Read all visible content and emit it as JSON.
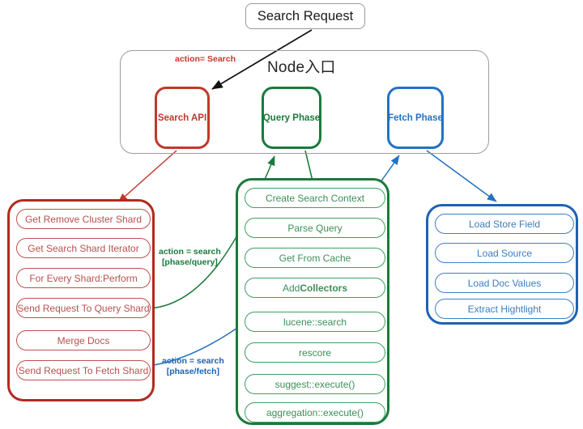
{
  "colors": {
    "red_dark": "#b22a20",
    "red": "#c0392b",
    "red_light": "#c0504d",
    "green": "#1a7a3c",
    "green_light": "#3f9e62",
    "blue": "#2272c4",
    "blue_dark": "#1b63b5",
    "blue_light": "#3f7fc4",
    "gray": "#9d9d9d",
    "black": "#111111"
  },
  "entry": {
    "label": "Search Request"
  },
  "node": {
    "title": "Node入口",
    "entry_edge_label": "action= Search"
  },
  "phases": [
    {
      "id": "search-api",
      "label": "Search API"
    },
    {
      "id": "query-phase",
      "label": "Query Phase"
    },
    {
      "id": "fetch-phase",
      "label": "Fetch Phase"
    }
  ],
  "edges": [
    {
      "id": "request-to-search-api",
      "label": "action= Search",
      "from": "Search Request",
      "to": "Search API",
      "color": "#111111"
    },
    {
      "id": "search-api-to-red-column",
      "label": "",
      "from": "Search API",
      "to": "Get Remove Cluster Shard",
      "color": "#c0392b"
    },
    {
      "id": "query-shard-to-query-phase",
      "label": "action = search\n[phase/query]",
      "from": "Send Request To Query Shard",
      "to": "Query Phase",
      "color": "#1a7a3c"
    },
    {
      "id": "query-phase-to-green-column",
      "label": "",
      "from": "Query Phase",
      "to": "Create Search Context",
      "color": "#1a7a3c"
    },
    {
      "id": "fetch-shard-to-fetch-phase",
      "label": "action = search\n[phase/fetch]",
      "from": "Send Request To Fetch Shard",
      "to": "Fetch Phase",
      "color": "#2272c4"
    },
    {
      "id": "fetch-phase-to-blue-column",
      "label": "",
      "from": "Fetch Phase",
      "to": "Load Store Field",
      "color": "#2272c4"
    }
  ],
  "edge_labels": {
    "query_line1": "action = search",
    "query_line2": "[phase/query]",
    "fetch_line1": "action = search",
    "fetch_line2": "[phase/fetch]"
  },
  "columns": {
    "red": {
      "id": "search-api-steps",
      "items": [
        "Get Remove Cluster Shard",
        "Get Search Shard Iterator",
        "For Every Shard:Perform",
        "Send Request To Query Shard",
        "Merge Docs",
        "Send Request To Fetch Shard"
      ]
    },
    "green": {
      "id": "query-phase-steps",
      "items": [
        "Create Search Context",
        "Parse Query",
        "Get From Cache",
        "Add Collectors",
        "lucene::search",
        "rescore",
        "suggest::execute()",
        "aggregation::execute()"
      ],
      "bold_item_index": 3,
      "bold_prefix": "Add ",
      "bold_word": "Collectors"
    },
    "blue": {
      "id": "fetch-phase-steps",
      "items": [
        "Load Store Field",
        "Load Source",
        "Load Doc Values",
        "Extract Hightlight"
      ]
    }
  }
}
